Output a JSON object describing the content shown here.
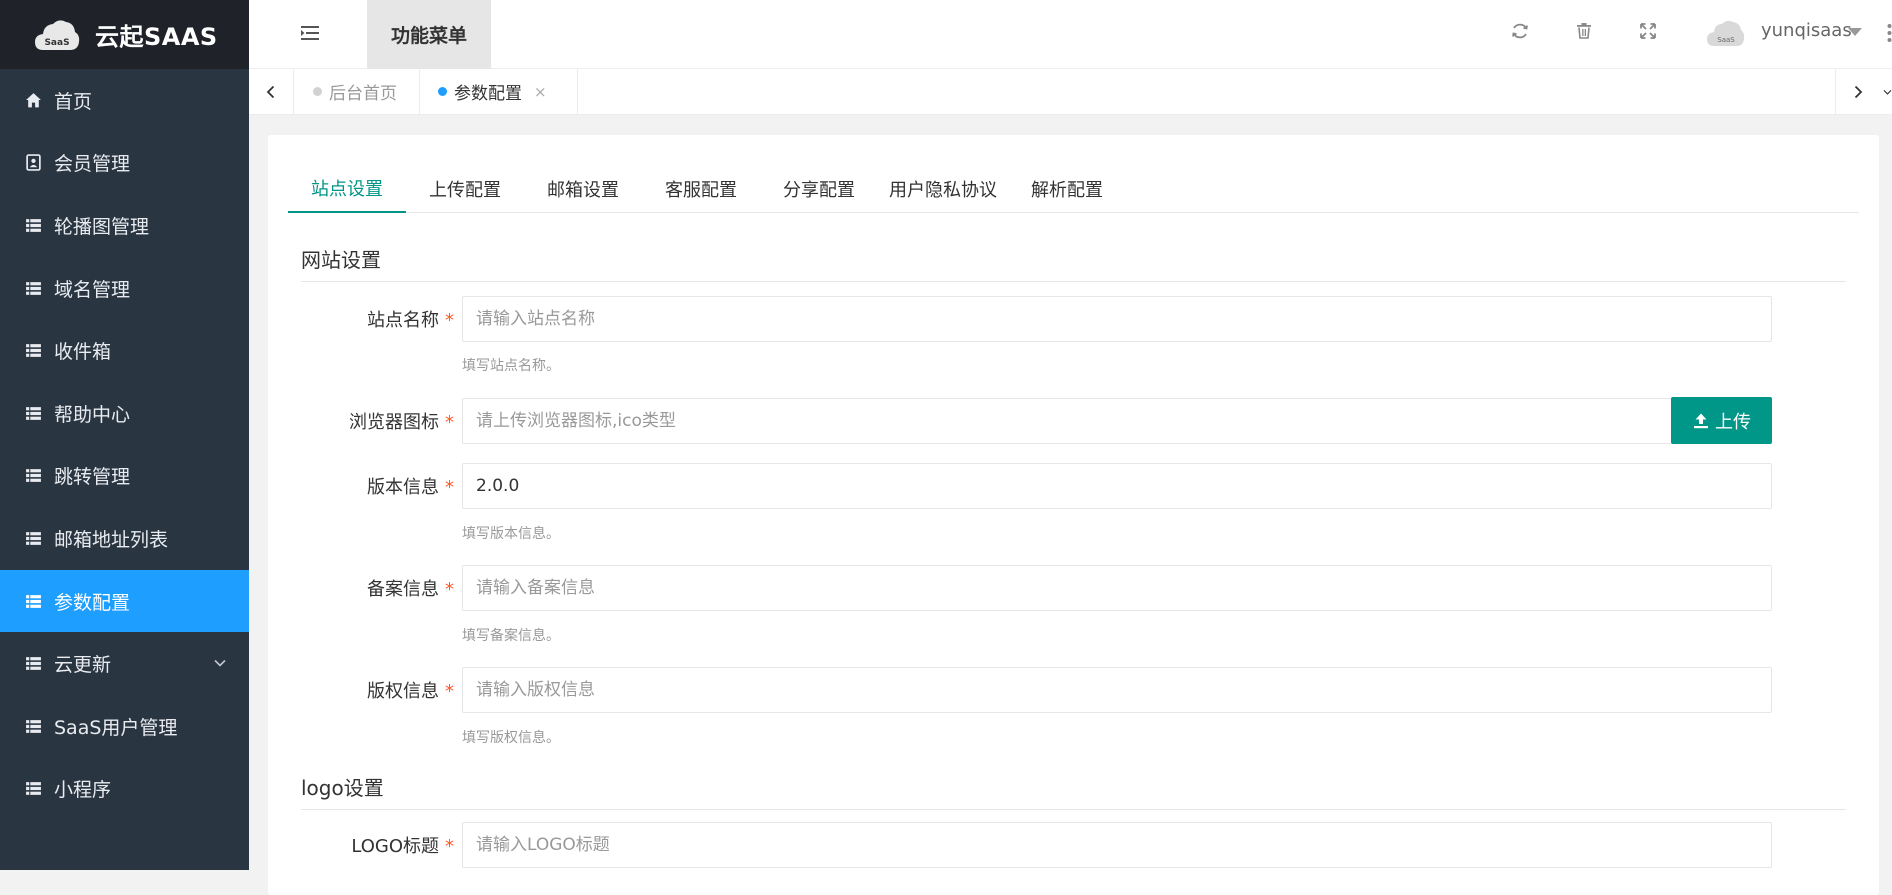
{
  "brand": {
    "title": "云起SAAS",
    "logo_text": "SaaS"
  },
  "sidebar": {
    "items": [
      {
        "label": "首页",
        "icon": "home-icon"
      },
      {
        "label": "会员管理",
        "icon": "contact-card-icon"
      },
      {
        "label": "轮播图管理",
        "icon": "list-icon"
      },
      {
        "label": "域名管理",
        "icon": "list-icon"
      },
      {
        "label": "收件箱",
        "icon": "list-icon"
      },
      {
        "label": "帮助中心",
        "icon": "list-icon"
      },
      {
        "label": "跳转管理",
        "icon": "list-icon"
      },
      {
        "label": "邮箱地址列表",
        "icon": "list-icon"
      },
      {
        "label": "参数配置",
        "icon": "list-icon",
        "active": true
      },
      {
        "label": "云更新",
        "icon": "list-icon",
        "has_submenu": true
      },
      {
        "label": "SaaS用户管理",
        "icon": "list-icon"
      },
      {
        "label": "小程序",
        "icon": "list-icon"
      }
    ]
  },
  "header": {
    "func_menu_label": "功能菜单",
    "username": "yunqisaas",
    "avatar_text": "SaaS"
  },
  "page_tabs": {
    "home_label": "后台首页",
    "current_label": "参数配置",
    "close_symbol": "×"
  },
  "config_tabs": [
    "站点设置",
    "上传配置",
    "邮箱设置",
    "客服配置",
    "分享配置",
    "用户隐私协议",
    "解析配置"
  ],
  "sections": {
    "website_title": "网站设置",
    "logo_title": "logo设置"
  },
  "form": {
    "required_mark": "*",
    "site_name": {
      "label": "站点名称",
      "placeholder": "请输入站点名称",
      "help": "填写站点名称。"
    },
    "favicon": {
      "label": "浏览器图标",
      "placeholder": "请上传浏览器图标,ico类型",
      "button": "上传"
    },
    "version": {
      "label": "版本信息",
      "value": "2.0.0",
      "help": "填写版本信息。"
    },
    "icp": {
      "label": "备案信息",
      "placeholder": "请输入备案信息",
      "help": "填写备案信息。"
    },
    "copyright": {
      "label": "版权信息",
      "placeholder": "请输入版权信息",
      "help": "填写版权信息。"
    },
    "logo_title": {
      "label": "LOGO标题",
      "placeholder": "请输入LOGO标题"
    }
  },
  "colors": {
    "sidebar_bg": "#2a3542",
    "active_blue": "#1e9fff",
    "accent_green": "#009688",
    "required_red": "#ff5722"
  }
}
